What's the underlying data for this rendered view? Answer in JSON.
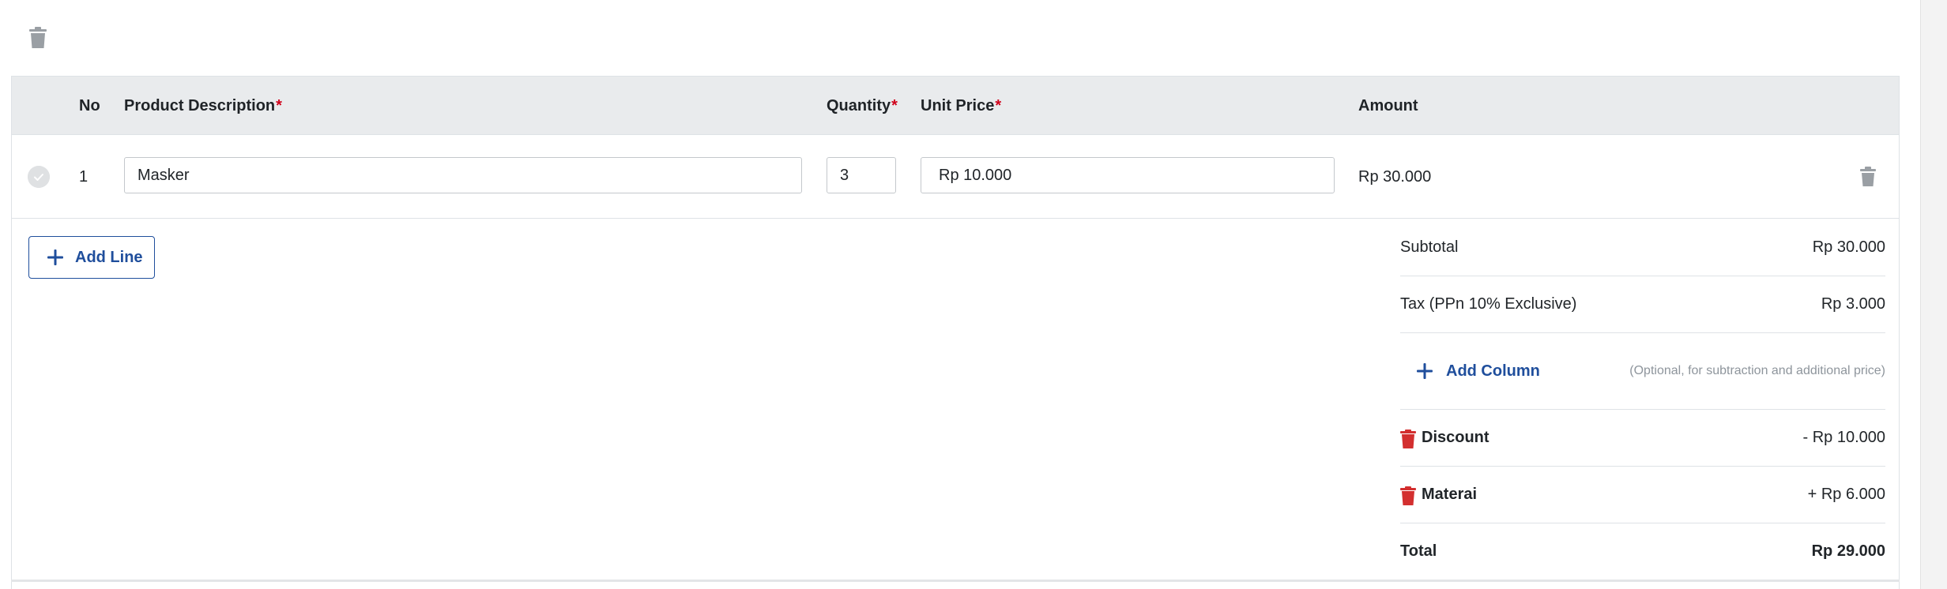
{
  "colors": {
    "accent": "#1f4e9c",
    "danger": "#d32f2f",
    "required": "#d0021b",
    "header_bg": "#e9ebed"
  },
  "table": {
    "headers": {
      "no": "No",
      "description": "Product Description",
      "quantity": "Quantity",
      "unit_price": "Unit Price",
      "amount": "Amount",
      "required_mark": "*"
    },
    "rows": [
      {
        "no": "1",
        "description": "Masker",
        "quantity": "3",
        "unit_price": "Rp 10.000",
        "amount": "Rp 30.000"
      }
    ]
  },
  "actions": {
    "add_line": "Add Line",
    "add_column": "Add Column",
    "add_column_hint": "(Optional, for subtraction and additional price)"
  },
  "summary": {
    "subtotal_label": "Subtotal",
    "subtotal_value": "Rp 30.000",
    "tax_label": "Tax (PPn 10% Exclusive)",
    "tax_value": "Rp 3.000",
    "extra_columns": [
      {
        "label": "Discount",
        "value": "- Rp 10.000"
      },
      {
        "label": "Materai",
        "value": "+ Rp 6.000"
      }
    ],
    "total_label": "Total",
    "total_value": "Rp 29.000"
  },
  "icons": {
    "top_delete": "trash-icon",
    "row_delete": "trash-icon",
    "row_select": "check-circle-icon",
    "add": "plus-icon",
    "column_delete": "trash-icon"
  }
}
